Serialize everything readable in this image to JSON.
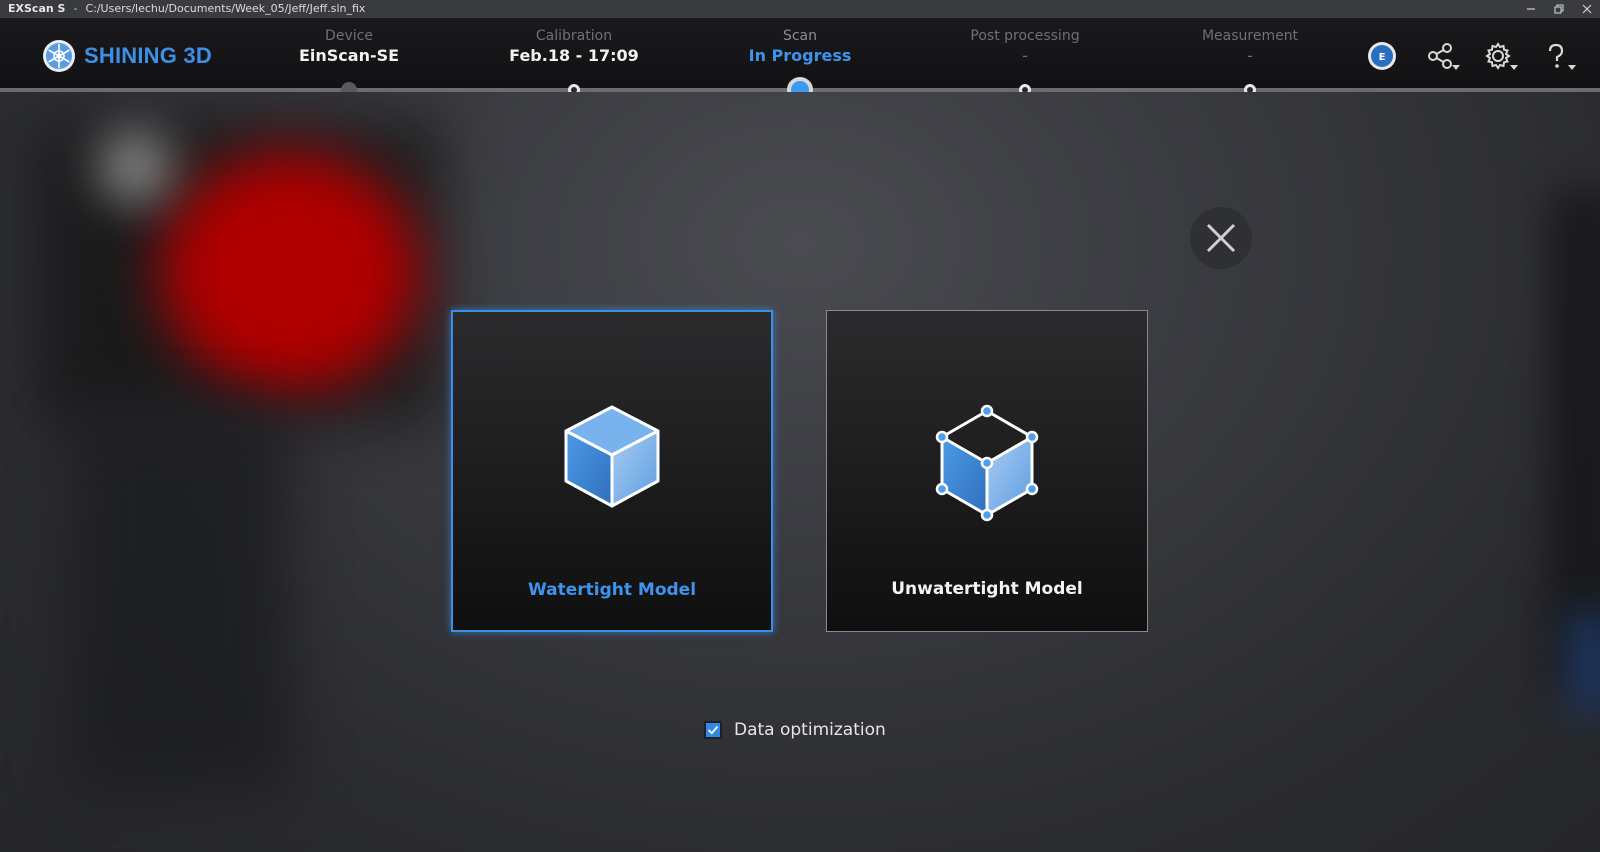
{
  "titlebar": {
    "app_name": "EXScan S",
    "separator": "-",
    "path": "C:/Users/lechu/Documents/Week_05/Jeff/Jeff.sln_fix"
  },
  "logo": {
    "text": "SHINING 3D",
    "icon": "shining3d-logo-icon",
    "color": "#3d8fe6"
  },
  "steps": [
    {
      "label": "Device",
      "value": "EinScan-SE",
      "state": "past"
    },
    {
      "label": "Calibration",
      "value": "Feb.18 - 17:09",
      "state": "done"
    },
    {
      "label": "Scan",
      "value": "In Progress",
      "state": "current"
    },
    {
      "label": "Post processing",
      "value": "-",
      "state": "pending"
    },
    {
      "label": "Measurement",
      "value": "-",
      "state": "pending"
    }
  ],
  "header_icons": [
    "einscan-badge-icon",
    "share-icon",
    "gear-icon",
    "help-icon"
  ],
  "dialog": {
    "options": [
      {
        "label": "Watertight Model",
        "selected": true,
        "icon": "solid-cube-icon"
      },
      {
        "label": "Unwatertight Model",
        "selected": false,
        "icon": "wireframe-cube-icon"
      }
    ],
    "data_optimization": {
      "label": "Data optimization",
      "checked": true
    }
  },
  "colors": {
    "accent": "#3d94ee",
    "background": "#2b2c30",
    "header": "#141416"
  }
}
